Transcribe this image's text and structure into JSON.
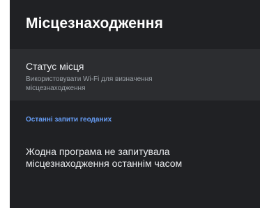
{
  "header": {
    "title": "Місцезнаходження"
  },
  "location_status": {
    "title": "Статус місця",
    "subtitle": "Використовувати Wi-Fi для визначення місцезнаходження"
  },
  "recent_requests": {
    "section_title": "Останні запити геоданих",
    "empty_message": "Жодна програма не запитувала місцезнаходження останнім часом"
  },
  "colors": {
    "background": "#202124",
    "selected_item": "#2c2d30",
    "accent": "#669df6",
    "primary_text": "#e8eaed",
    "secondary_text": "#9aa0a6"
  }
}
